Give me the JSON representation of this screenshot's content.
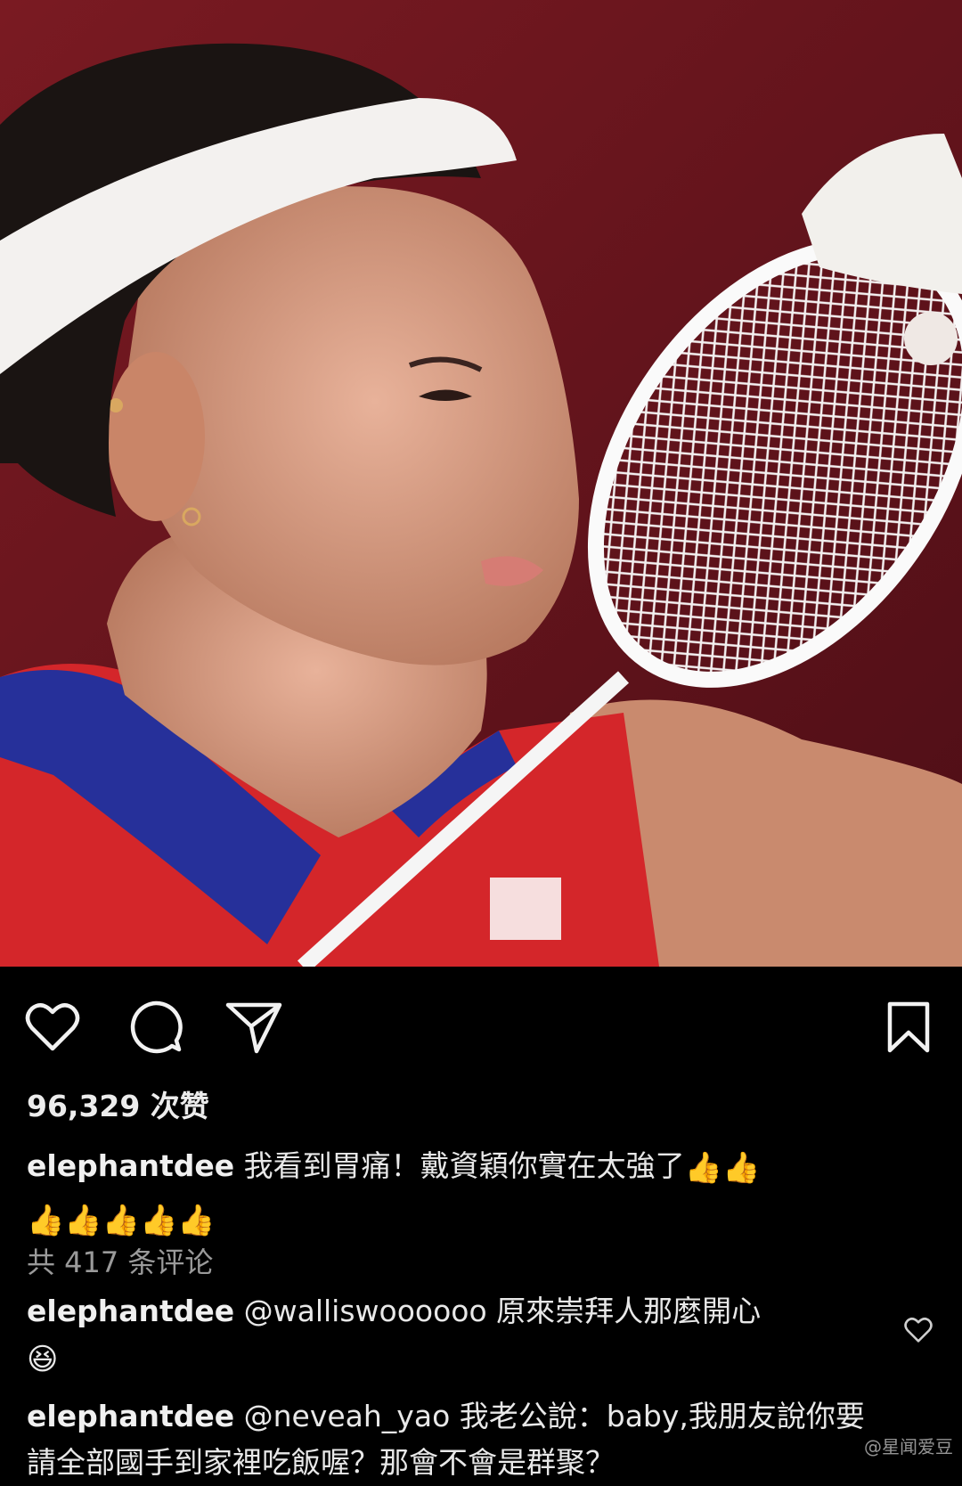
{
  "post": {
    "likes_text": "96,329 次赞",
    "caption": {
      "username": "elephantdee",
      "text": "我看到胃痛！戴資穎你實在太強了",
      "emoji_line1": "👍👍",
      "emoji_line2": "👍👍👍👍👍"
    },
    "comments_link": "共 417 条评论"
  },
  "comments": [
    {
      "username": "elephantdee",
      "mention": "@walliswoooooo",
      "text": "原來崇拜人那麼開心",
      "emoji": "😆"
    },
    {
      "username": "elephantdee",
      "mention": "@neveah_yao",
      "text": "我老公說：baby,我朋友說你要請全部國手到家裡吃飯喔？那會不會是群聚？"
    }
  ],
  "icons": {
    "like": "heart-icon",
    "comment": "comment-icon",
    "share": "send-icon",
    "save": "bookmark-icon"
  },
  "watermark": "@星闻爱豆",
  "colors": {
    "background": "#000000",
    "text": "#e8e8e8",
    "muted": "#9a9a9a",
    "jersey_red": "#d4262a",
    "backdrop": "#6a1520"
  }
}
